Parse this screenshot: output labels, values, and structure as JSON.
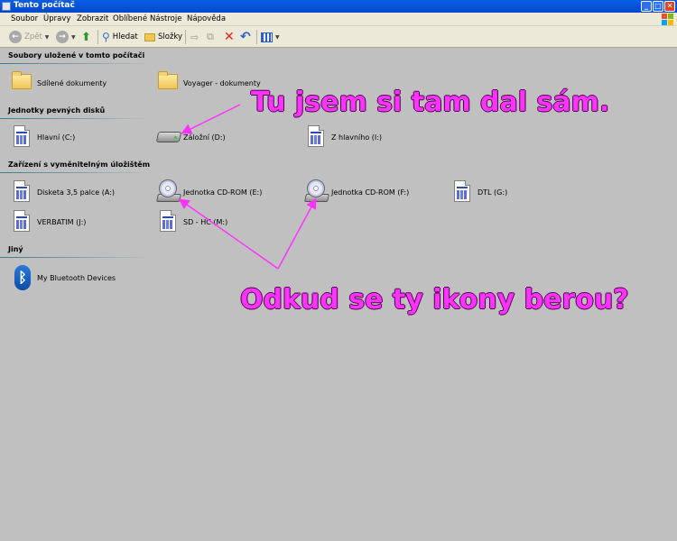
{
  "window": {
    "title": "Tento počítač",
    "buttons": {
      "minimize": "_",
      "maximize": "□",
      "close": "✕"
    }
  },
  "menu": [
    "Soubor",
    "Úpravy",
    "Zobrazit",
    "Oblíbené",
    "Nástroje",
    "Nápověda"
  ],
  "toolbar": {
    "back_label": "Zpět",
    "search_label": "Hledat",
    "folders_label": "Složky"
  },
  "groups": {
    "shared": {
      "header": "Soubory uložené v tomto počítači",
      "items": [
        "Sdílené dokumenty",
        "Voyager - dokumenty"
      ]
    },
    "hdd": {
      "header": "Jednotky pevných disků",
      "items": [
        "Hlavní (C:)",
        "Záložní (D:)",
        "Z hlavního (I:)"
      ]
    },
    "removable": {
      "header": "Zařízení s vyměnitelným úložištěm",
      "items": [
        "Disketa 3,5 palce (A:)",
        "Jednotka CD-ROM (E:)",
        "Jednotka CD-ROM (F:)",
        "DTL (G:)",
        "VERBATIM (J:)",
        "SD - HC (M:)"
      ]
    },
    "other": {
      "header": "Jiný",
      "items": [
        "My Bluetooth Devices"
      ]
    }
  },
  "annotations": {
    "top": "Tu jsem si tam dal sám.",
    "bottom": "Odkud se ty ikony berou?"
  },
  "colors": {
    "annotation": "#ff33ff",
    "background": "#c0c0c0",
    "titlebar": "#0a5ee8"
  }
}
